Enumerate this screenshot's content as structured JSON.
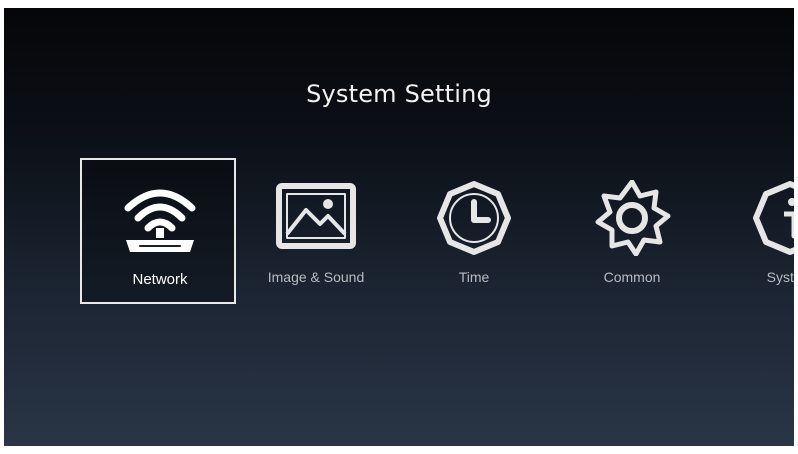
{
  "page": {
    "title": "System Setting"
  },
  "menu": {
    "selected_index": 0,
    "items": [
      {
        "label": "Network",
        "icon": "wifi-router-icon"
      },
      {
        "label": "Image & Sound",
        "icon": "image-icon"
      },
      {
        "label": "Time",
        "icon": "clock-icon"
      },
      {
        "label": "Common",
        "icon": "gear-icon"
      },
      {
        "label": "System",
        "icon": "info-icon"
      }
    ]
  },
  "colors": {
    "background_top": "#050608",
    "background_bottom": "#2a3546",
    "title_text": "#f2f2f2",
    "selected_border": "#e8e8e8",
    "icon": "#e6e6e6",
    "label_inactive": "#b8bcc2"
  }
}
